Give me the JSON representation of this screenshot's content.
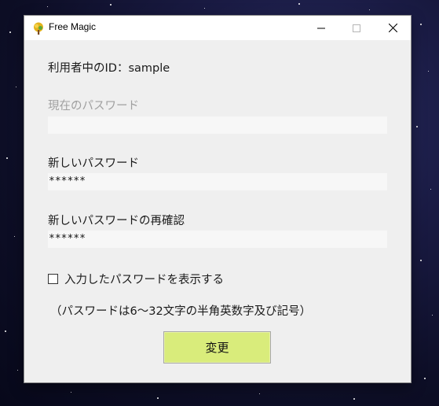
{
  "window": {
    "title": "Free Magic",
    "icon": "tree-icon",
    "controls": {
      "minimize": "minimize-icon",
      "maximize": "maximize-icon",
      "close": "close-icon"
    }
  },
  "form": {
    "user_id_label": "利用者中のID：sample",
    "current_password": {
      "label": "現在のパスワード",
      "value": ""
    },
    "new_password": {
      "label": "新しいパスワード",
      "value": "******"
    },
    "confirm_password": {
      "label": "新しいパスワードの再確認",
      "value": "******"
    },
    "show_password_checkbox": {
      "label": "入力したパスワードを表示する",
      "checked": false
    },
    "note": "（パスワードは6～32文字の半角英数字及び記号）",
    "submit_label": "変更"
  },
  "colors": {
    "submit_button": "#d9ec7b",
    "window_background": "#efefef",
    "field_background": "#f7f7f7",
    "disabled_text": "#a0a0a0"
  }
}
